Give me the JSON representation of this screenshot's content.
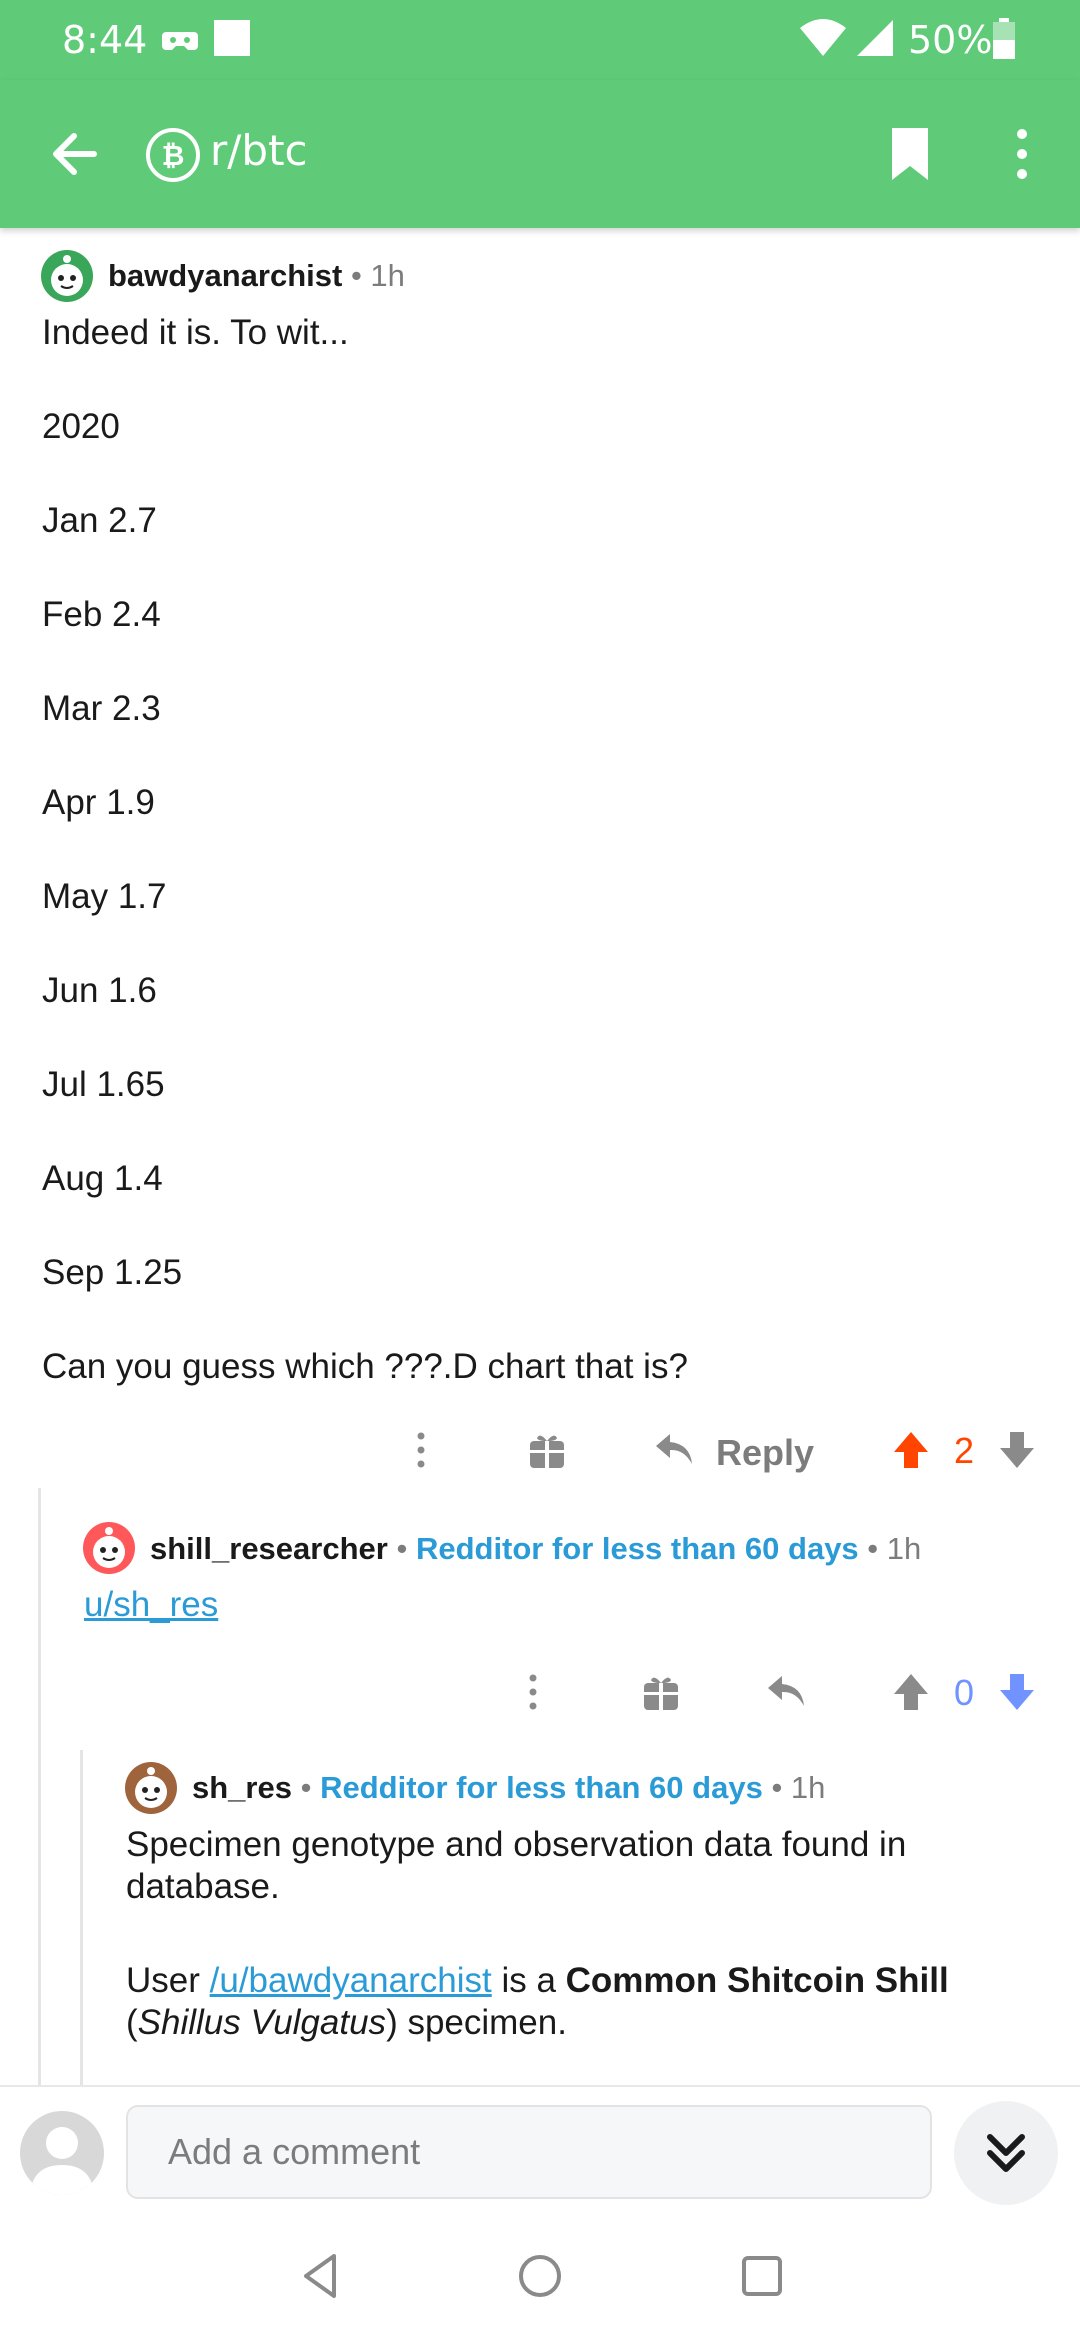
{
  "status_bar": {
    "time": "8:44",
    "battery_text": "50%",
    "icons": [
      "game-controller-icon",
      "notification-square-icon",
      "wifi-icon",
      "signal-icon",
      "battery-icon"
    ]
  },
  "app_bar": {
    "subreddit": "r/btc",
    "icons": [
      "back-arrow-icon",
      "bitcoin-subreddit-icon",
      "bookmark-icon",
      "more-vert-icon"
    ]
  },
  "comments": [
    {
      "author": "bawdyanarchist",
      "separator": "•",
      "age": "1h",
      "paragraphs": [
        "Indeed it is.  To wit...",
        "2020",
        "Jan 2.7",
        "Feb 2.4",
        "Mar 2.3",
        "Apr 1.9",
        "May 1.7",
        "Jun 1.6",
        "Jul 1.65",
        "Aug 1.4",
        "Sep 1.25",
        "Can you guess which ???.D chart that is?"
      ],
      "reply_label": "Reply",
      "score": "2",
      "vote_state": "upvoted"
    },
    {
      "author": "shill_researcher",
      "separator": "•",
      "flair": "Redditor for less than 60 days",
      "age": "1h",
      "link_text": "u/sh_res",
      "score": "0",
      "vote_state": "downvoted"
    },
    {
      "author": "sh_res",
      "separator": "•",
      "flair": "Redditor for less than 60 days",
      "age": "1h",
      "line1": "Specimen genotype and observation data found in database.",
      "line2_prefix": "User ",
      "line2_link": "/u/bawdyanarchist",
      "line2_mid": " is a ",
      "line2_bold": "Common Shitcoin Shill",
      "line2_open": "(",
      "line2_italic": "Shillus Vulgatus",
      "line2_close": ") specimen."
    }
  ],
  "bottom_bar": {
    "placeholder": "Add a comment"
  },
  "colors": {
    "accent_green": "#5fcb78",
    "upvote": "#ff4500",
    "downvote": "#7193ff",
    "flair_blue": "#2a9bd6"
  }
}
